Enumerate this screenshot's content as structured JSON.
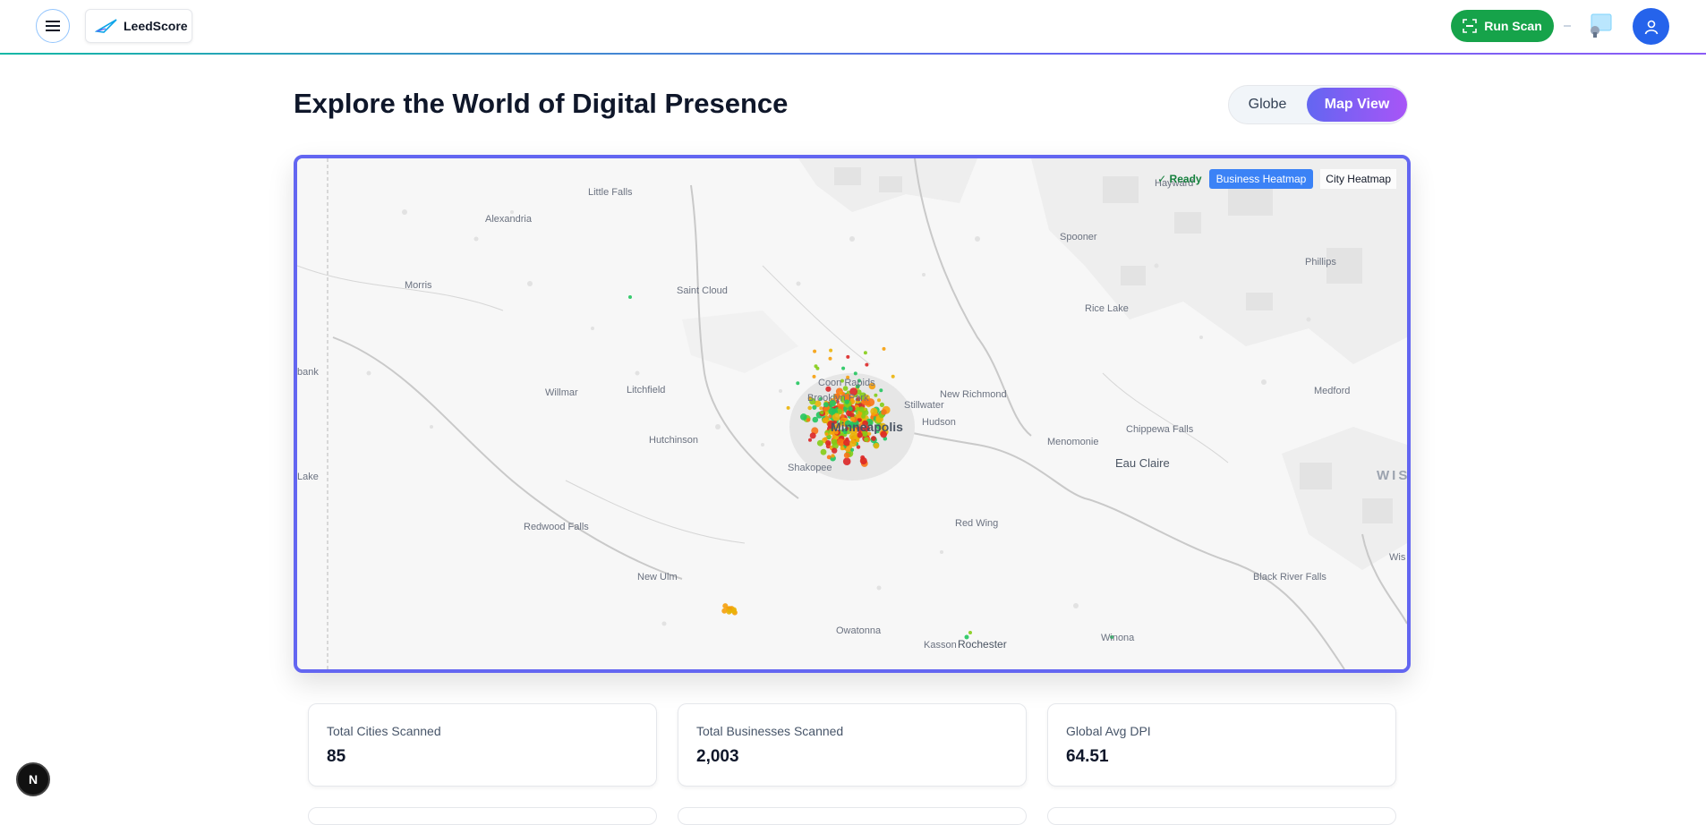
{
  "app": {
    "name": "LeedScore"
  },
  "header": {
    "run_scan_label": "Run Scan"
  },
  "main": {
    "title": "Explore the World of Digital Presence",
    "view_toggle": {
      "globe": "Globe",
      "map": "Map View",
      "active": "Map View"
    }
  },
  "map": {
    "status": "✓ Ready",
    "layer_buttons": {
      "business": "Business Heatmap",
      "city": "City Heatmap",
      "active": "Business Heatmap"
    },
    "place_labels": {
      "little_falls": "Little Falls",
      "alexandria": "Alexandria",
      "morris": "Morris",
      "saint_cloud": "Saint Cloud",
      "bank": "bank",
      "willmar": "Willmar",
      "litchfield": "Litchfield",
      "hutchinson": "Hutchinson",
      "lake": "Lake",
      "redwood_falls": "Redwood Falls",
      "new_ulm": "New Ulm",
      "owatonna": "Owatonna",
      "kasson": "Kasson",
      "rochester": "Rochester",
      "winona": "Winona",
      "red_wing": "Red Wing",
      "minneapolis": "Minneapolis",
      "coon_rapids": "Coon Rapids",
      "brooklyn_park": "Brooklyn Park",
      "shakopee": "Shakopee",
      "stillwater": "Stillwater",
      "hudson": "Hudson",
      "new_richmond": "New Richmond",
      "hayward": "Hayward",
      "spooner": "Spooner",
      "phillips": "Phillips",
      "rice_lake": "Rice Lake",
      "medford": "Medford",
      "chippewa_falls": "Chippewa Falls",
      "menomonie": "Menomonie",
      "eau_claire": "Eau Claire",
      "black_river_falls": "Black River Falls",
      "wisconsin": "WIS",
      "wis_edge": "Wis"
    },
    "point_colors": [
      "#84cc16",
      "#eab308",
      "#f59e0b",
      "#f97316",
      "#dc2626",
      "#22c55e"
    ]
  },
  "stats": [
    {
      "label": "Total Cities Scanned",
      "value": "85"
    },
    {
      "label": "Total Businesses Scanned",
      "value": "2,003"
    },
    {
      "label": "Global Avg DPI",
      "value": "64.51"
    }
  ],
  "dev_badge": "N"
}
